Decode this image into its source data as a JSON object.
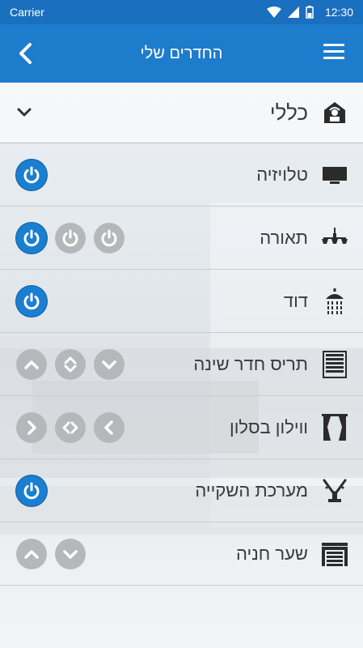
{
  "status_bar": {
    "carrier": "Carrier",
    "time": "12:30"
  },
  "app_bar": {
    "title": "החדרים שלי"
  },
  "rooms": {
    "general": {
      "label": "כללי"
    },
    "items": [
      {
        "label": "טלויזיה",
        "icon": "tv-icon"
      },
      {
        "label": "תאורה",
        "icon": "chandelier-icon"
      },
      {
        "label": "דוד",
        "icon": "shower-icon"
      },
      {
        "label": "תריס חדר שינה",
        "icon": "shutter-icon"
      },
      {
        "label": "ווילון בסלון",
        "icon": "curtain-icon"
      },
      {
        "label": "מערכת השקייה",
        "icon": "sprinkler-icon"
      },
      {
        "label": "שער חניה",
        "icon": "garage-icon"
      }
    ]
  },
  "colors": {
    "primary": "#1e7ccd",
    "status": "#1a6fbf",
    "power_on": "#1a7fd1",
    "control_gray": "#b5b8bb"
  }
}
